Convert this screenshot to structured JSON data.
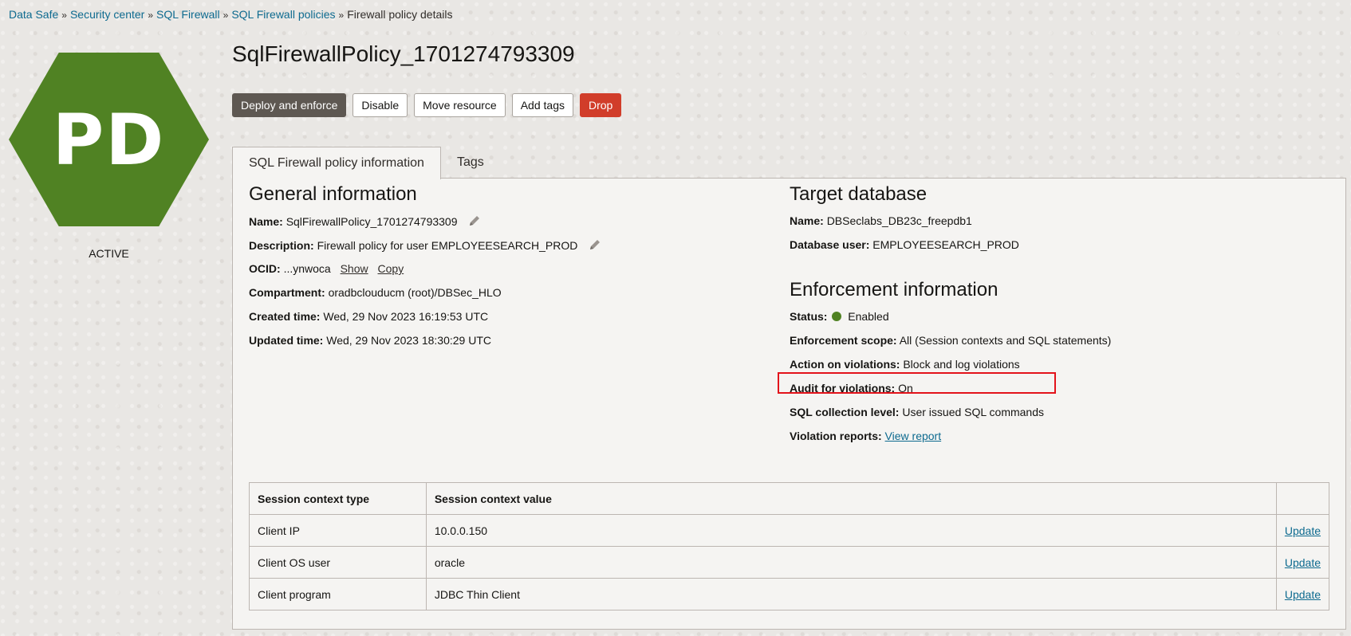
{
  "breadcrumb": {
    "items": [
      "Data Safe",
      "Security center",
      "SQL Firewall",
      "SQL Firewall policies"
    ],
    "current": "Firewall policy details",
    "separator": "»"
  },
  "badge": {
    "initials": "PD",
    "color": "#508223",
    "state": "ACTIVE"
  },
  "title": "SqlFirewallPolicy_1701274793309",
  "actions": {
    "deploy": "Deploy and enforce",
    "disable": "Disable",
    "move": "Move resource",
    "add_tags": "Add tags",
    "drop": "Drop"
  },
  "tabs": [
    {
      "label": "SQL Firewall policy information",
      "active": true
    },
    {
      "label": "Tags",
      "active": false
    }
  ],
  "general": {
    "heading": "General information",
    "name_label": "Name:",
    "name": "SqlFirewallPolicy_1701274793309",
    "description_label": "Description:",
    "description": "Firewall policy for user EMPLOYEESEARCH_PROD",
    "ocid_label": "OCID:",
    "ocid": "...ynwoca",
    "ocid_show": "Show",
    "ocid_copy": "Copy",
    "compartment_label": "Compartment:",
    "compartment": "oradbclouducm (root)/DBSec_HLO",
    "created_label": "Created time:",
    "created": "Wed, 29 Nov 2023 16:19:53 UTC",
    "updated_label": "Updated time:",
    "updated": "Wed, 29 Nov 2023 18:30:29 UTC"
  },
  "target": {
    "heading": "Target database",
    "name_label": "Name:",
    "name": "DBSeclabs_DB23c_freepdb1",
    "db_user_label": "Database user:",
    "db_user": "EMPLOYEESEARCH_PROD"
  },
  "enforcement": {
    "heading": "Enforcement information",
    "status_label": "Status:",
    "status": "Enabled",
    "status_color": "#508223",
    "scope_label": "Enforcement scope:",
    "scope": "All (Session contexts and SQL statements)",
    "action_label": "Action on violations:",
    "action": "Block and log violations",
    "audit_label": "Audit for violations:",
    "audit": "On",
    "collection_label": "SQL collection level:",
    "collection": "User issued SQL commands",
    "reports_label": "Violation reports:",
    "reports_link": "View report"
  },
  "highlight_color": "#e3131b",
  "table": {
    "headers": [
      "Session context type",
      "Session context value",
      ""
    ],
    "rows": [
      {
        "type": "Client IP",
        "value": "10.0.0.150",
        "action": "Update"
      },
      {
        "type": "Client OS user",
        "value": "oracle",
        "action": "Update"
      },
      {
        "type": "Client program",
        "value": "JDBC Thin Client",
        "action": "Update"
      }
    ]
  }
}
